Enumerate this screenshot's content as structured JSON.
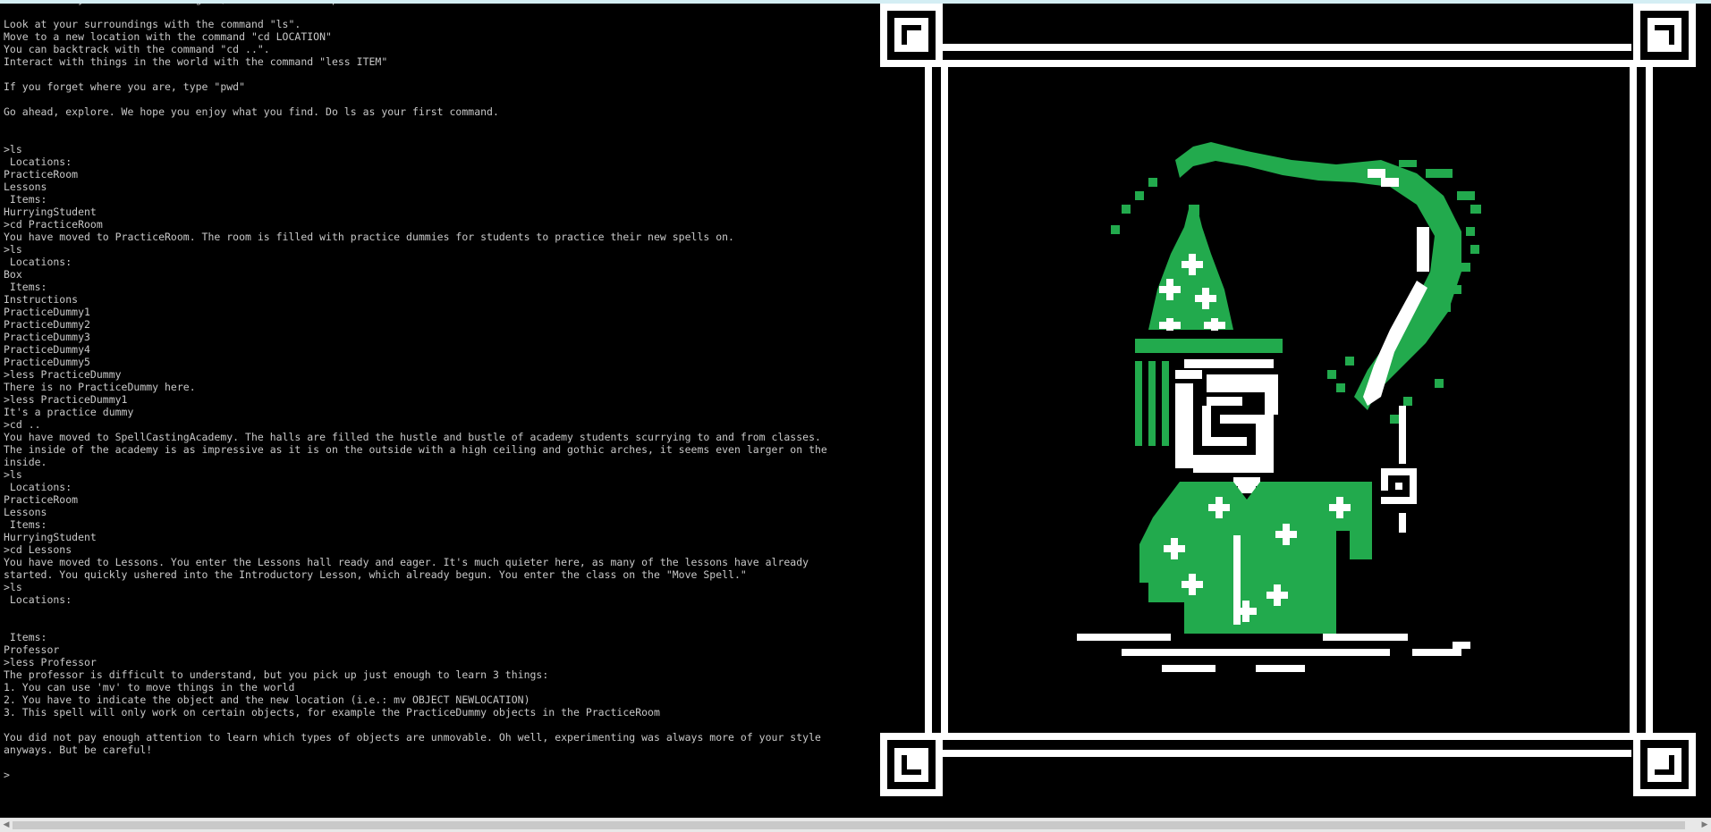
{
  "terminal": {
    "lines": [
      "Welcome! If you are new to the game, here are some tips:",
      "",
      "Look at your surroundings with the command \"ls\".",
      "Move to a new location with the command \"cd LOCATION\"",
      "You can backtrack with the command \"cd ..\".",
      "Interact with things in the world with the command \"less ITEM\"",
      "",
      "If you forget where you are, type \"pwd\"",
      "",
      "Go ahead, explore. We hope you enjoy what you find. Do ls as your first command.",
      "",
      "",
      ">ls",
      " Locations:",
      "PracticeRoom",
      "Lessons",
      " Items:",
      "HurryingStudent",
      ">cd PracticeRoom",
      "You have moved to PracticeRoom. The room is filled with practice dummies for students to practice their new spells on.",
      ">ls",
      " Locations:",
      "Box",
      " Items:",
      "Instructions",
      "PracticeDummy1",
      "PracticeDummy2",
      "PracticeDummy3",
      "PracticeDummy4",
      "PracticeDummy5",
      ">less PracticeDummy",
      "There is no PracticeDummy here.",
      ">less PracticeDummy1",
      "It's a practice dummy",
      ">cd ..",
      "You have moved to SpellCastingAcademy. The halls are filled the hustle and bustle of academy students scurrying to and from classes.",
      "The inside of the academy is as impressive as it is on the outside with a high ceiling and gothic arches, it seems even larger on the",
      "inside.",
      ">ls",
      " Locations:",
      "PracticeRoom",
      "Lessons",
      " Items:",
      "HurryingStudent",
      ">cd Lessons",
      "You have moved to Lessons. You enter the Lessons hall ready and eager. It's much quieter here, as many of the lessons have already",
      "started. You quickly ushered into the Introductory Lesson, which already begun. You enter the class on the \"Move Spell.\"",
      ">ls",
      " Locations:",
      "",
      "",
      " Items:",
      "Professor",
      ">less Professor",
      "The professor is difficult to understand, but you pick up just enough to learn 3 things:",
      "1. You can use 'mv' to move things in the world",
      "2. You have to indicate the object and the new location (i.e.: mv OBJECT NEWLOCATION)",
      "3. This spell will only work on certain objects, for example the PracticeDummy objects in the PracticeRoom",
      "",
      "You did not pay enough attention to learn which types of objects are unmovable. Oh well, experimenting was always more of your style",
      "anyways. But be careful!",
      "",
      ">"
    ]
  },
  "art": {
    "name": "wizard-pixel-art",
    "colors": {
      "background": "#000000",
      "frame": "#ffffff",
      "robe": "#22aa4d",
      "accent": "#ffffff"
    }
  },
  "scrollbar": {
    "left_arrow": "◀",
    "right_arrow": "▶"
  }
}
